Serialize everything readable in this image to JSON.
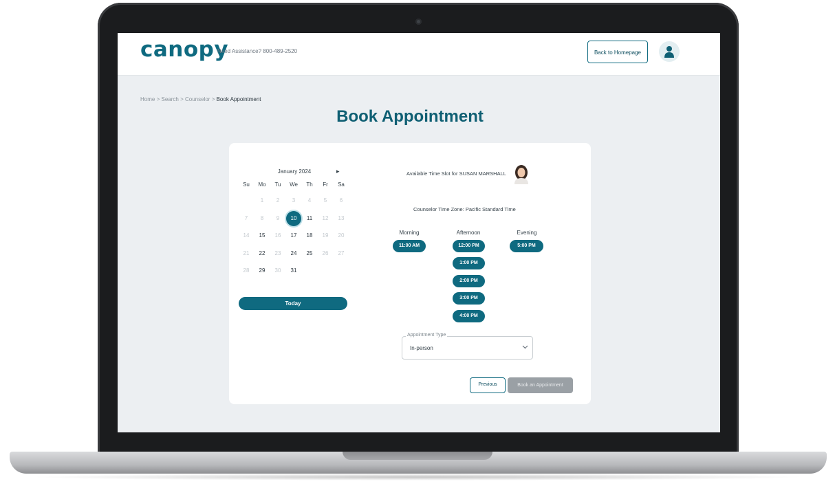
{
  "header": {
    "logo": "canopy",
    "assistance": "Need Assistance? 800-489-2520",
    "back_button": "Back to Homepage"
  },
  "breadcrumb": {
    "items": [
      "Home",
      "Search",
      "Counselor"
    ],
    "current": "Book Appointment"
  },
  "page_title": "Book Appointment",
  "calendar": {
    "month": "January 2024",
    "weekdays": [
      "Su",
      "Mo",
      "Tu",
      "We",
      "Th",
      "Fr",
      "Sa"
    ],
    "days": [
      "1",
      "2",
      "3",
      "4",
      "5",
      "6",
      "7",
      "8",
      "9",
      "10",
      "11",
      "12",
      "13",
      "14",
      "15",
      "16",
      "17",
      "18",
      "19",
      "20",
      "21",
      "22",
      "23",
      "24",
      "25",
      "26",
      "27",
      "28",
      "29",
      "30",
      "31"
    ],
    "selected_day": "10",
    "available_days": [
      "11",
      "15",
      "17",
      "18",
      "22",
      "24",
      "25",
      "29",
      "31"
    ],
    "today_button": "Today"
  },
  "availability": {
    "title": "Available Time Slot for SUSAN MARSHALL",
    "timezone": "Counselor Time Zone: Pacific Standard Time",
    "columns": [
      {
        "label": "Morning",
        "slots": [
          "11:00 AM"
        ]
      },
      {
        "label": "Afternoon",
        "slots": [
          "12:00 PM",
          "1:00 PM",
          "2:00 PM",
          "3:00 PM",
          "4:00 PM"
        ]
      },
      {
        "label": "Evening",
        "slots": [
          "5:00 PM"
        ]
      }
    ]
  },
  "appointment_type": {
    "label": "Appointment Type",
    "value": "In-person"
  },
  "actions": {
    "previous": "Previous",
    "book": "Book an Appointment"
  },
  "colors": {
    "brand": "#0f6a80",
    "disabled_button": "#9aa0a5",
    "screen_bg": "#eceff2"
  }
}
